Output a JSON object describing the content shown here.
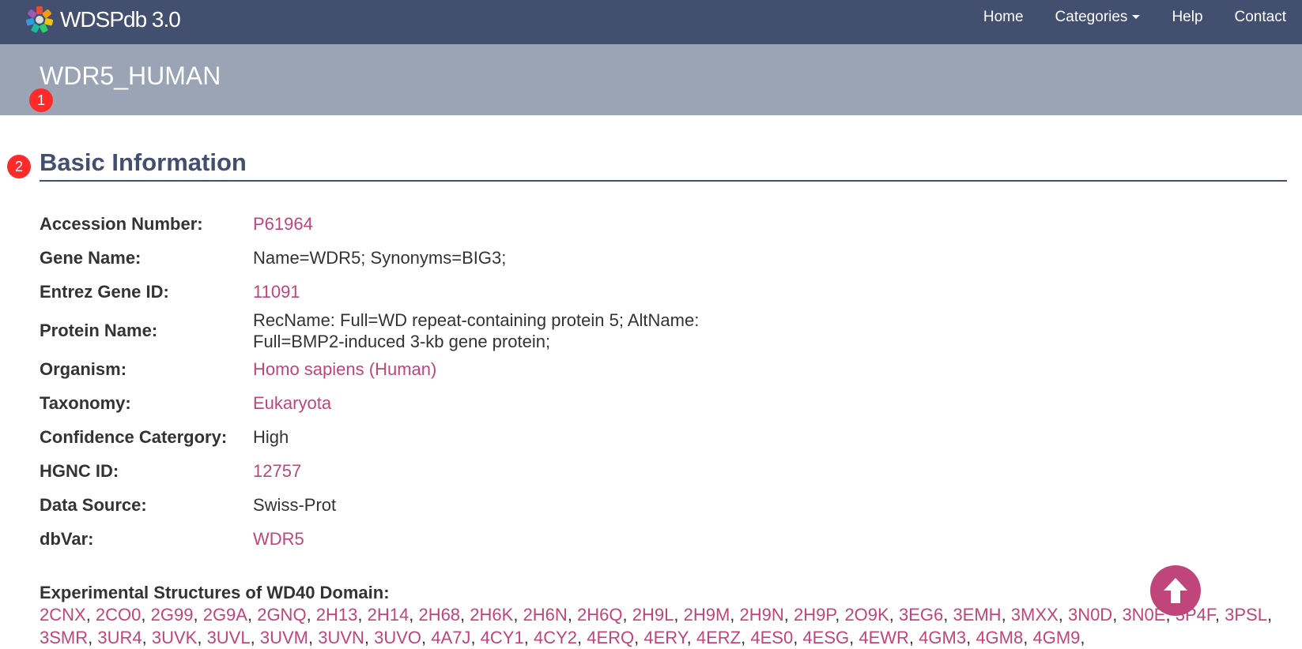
{
  "navbar": {
    "brand": "WDSPdb 3.0",
    "items": [
      {
        "label": "Home"
      },
      {
        "label": "Categories"
      },
      {
        "label": "Help"
      },
      {
        "label": "Contact"
      }
    ]
  },
  "header": {
    "title": "WDR5_HUMAN"
  },
  "markers": [
    "1",
    "2"
  ],
  "basic_info": {
    "section_title": "Basic Information",
    "accession_label": "Accession Number:",
    "accession": "P61964",
    "gene_name_label": "Gene Name:",
    "gene_name": "Name=WDR5; Synonyms=BIG3;",
    "entrez_label": "Entrez Gene ID:",
    "entrez": "11091",
    "protein_name_label": "Protein Name:",
    "protein_name_line1": "RecName: Full=WD repeat-containing protein 5; AltName:",
    "protein_name_line2": "Full=BMP2-induced 3-kb gene protein;",
    "organism_label": "Organism:",
    "organism": "Homo sapiens (Human)",
    "taxonomy_label": "Taxonomy:",
    "taxonomy": "Eukaryota",
    "confidence_label": "Confidence Catergory:",
    "confidence": "High",
    "hgnc_label": "HGNC ID:",
    "hgnc": "12757",
    "source_label": "Data Source:",
    "source": "Swiss-Prot",
    "dbvar_label": "dbVar:",
    "dbvar": "WDR5"
  },
  "experimental_structures": {
    "title": "Experimental Structures of WD40 Domain:",
    "ids": [
      "2CNX",
      "2CO0",
      "2G99",
      "2G9A",
      "2GNQ",
      "2H13",
      "2H14",
      "2H68",
      "2H6K",
      "2H6N",
      "2H6Q",
      "2H9L",
      "2H9M",
      "2H9N",
      "2H9P",
      "2O9K",
      "3EG6",
      "3EMH",
      "3MXX",
      "3N0D",
      "3N0E",
      "3P4F",
      "3PSL",
      "3SMR",
      "3UR4",
      "3UVK",
      "3UVL",
      "3UVM",
      "3UVN",
      "3UVO",
      "4A7J",
      "4CY1",
      "4CY2",
      "4ERQ",
      "4ERY",
      "4ERZ",
      "4ES0",
      "4ESG",
      "4EWR",
      "4GM3",
      "4GM8",
      "4GM9"
    ]
  },
  "colors": {
    "navbar": "#434f6e",
    "header_band": "#9aa4b5",
    "link": "#c0457a",
    "marker": "#ff2b2b"
  },
  "icons": {
    "brand": "wdspdb-logo-icon",
    "scroll_top": "arrow-up-icon"
  }
}
